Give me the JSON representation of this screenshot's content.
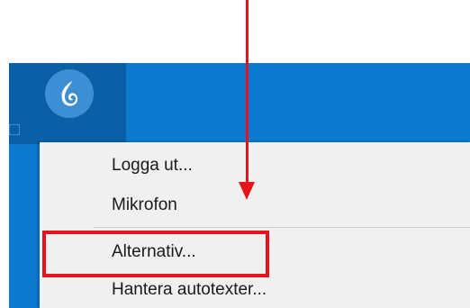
{
  "menu": {
    "items": [
      {
        "label": "Logga ut..."
      },
      {
        "label": "Mikrofon"
      },
      {
        "label": "Alternativ..."
      },
      {
        "label": "Hantera autotexter..."
      }
    ]
  },
  "colors": {
    "taskbar": "#0d7ad1",
    "tile": "#0a5fa6",
    "annotation": "#e8121b",
    "menu_bg": "#f0f0f0"
  },
  "icons": {
    "tray": "dragon-naturallyspeaking-icon"
  }
}
